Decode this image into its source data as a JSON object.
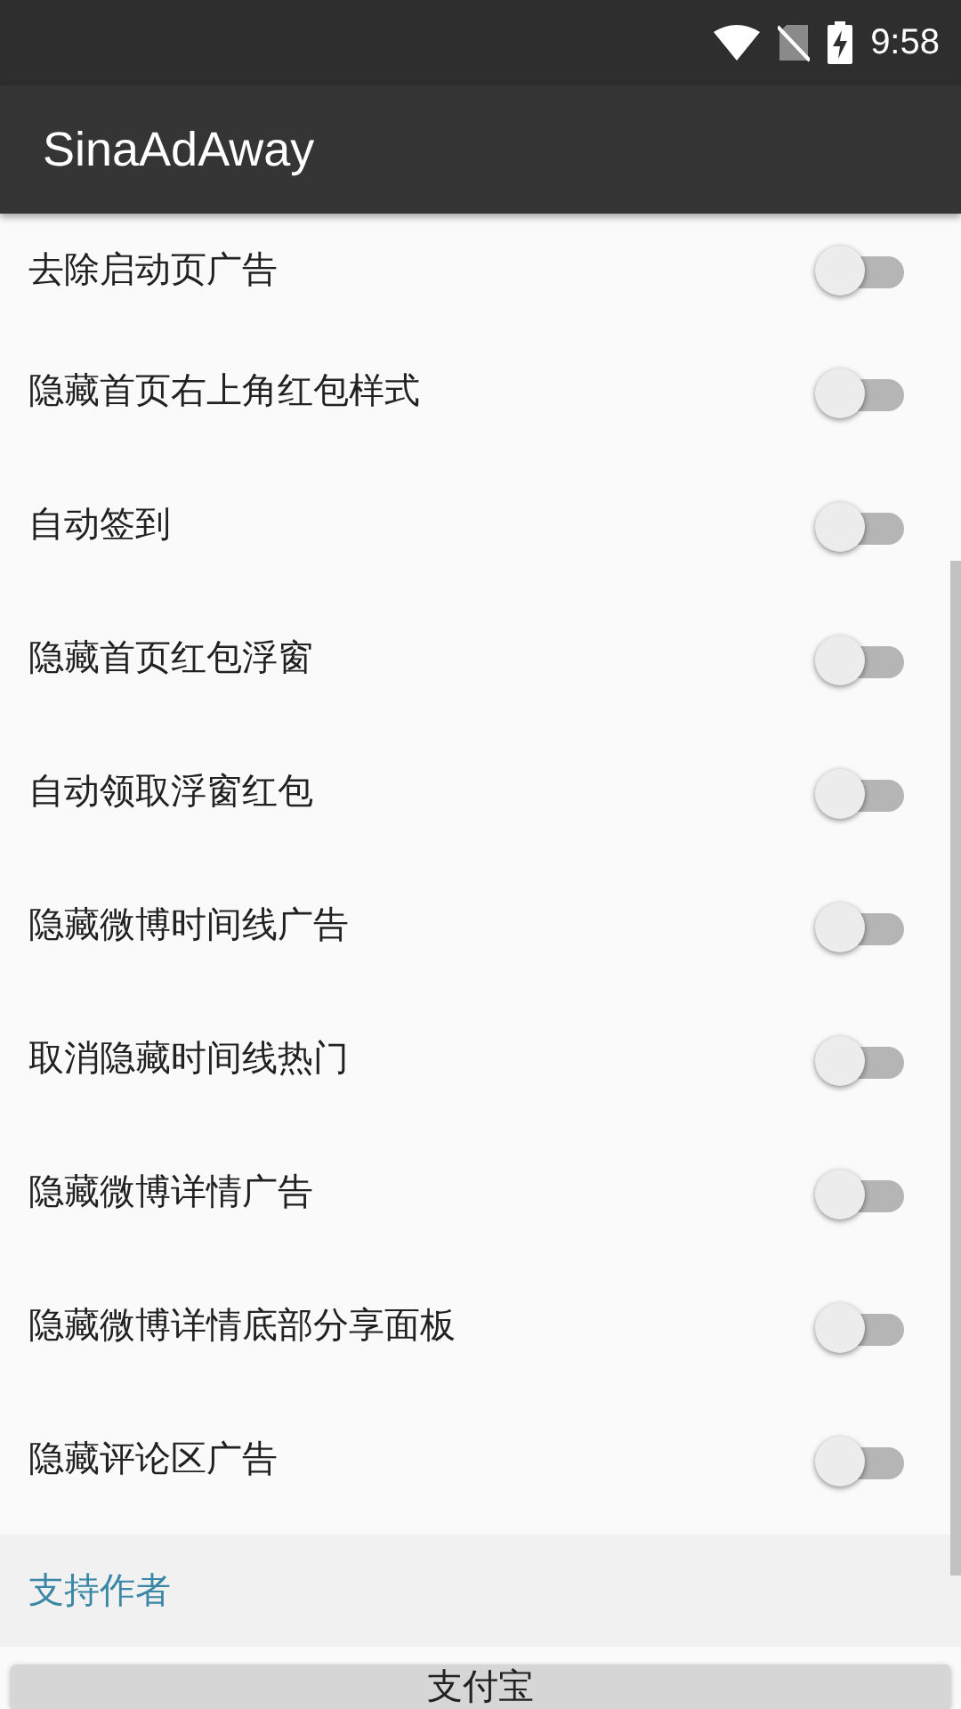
{
  "status_bar": {
    "time": "9:58"
  },
  "toolbar": {
    "title": "SinaAdAway"
  },
  "settings": [
    {
      "label": "去除启动页广告",
      "on": false
    },
    {
      "label": "隐藏首页右上角红包样式",
      "on": false
    },
    {
      "label": "自动签到",
      "on": false
    },
    {
      "label": "隐藏首页红包浮窗",
      "on": false
    },
    {
      "label": "自动领取浮窗红包",
      "on": false
    },
    {
      "label": "隐藏微博时间线广告",
      "on": false
    },
    {
      "label": "取消隐藏时间线热门",
      "on": false
    },
    {
      "label": "隐藏微博详情广告",
      "on": false
    },
    {
      "label": "隐藏微博详情底部分享面板",
      "on": false
    },
    {
      "label": "隐藏评论区广告",
      "on": false
    }
  ],
  "section": {
    "title": "支持作者"
  },
  "buttons": [
    "支付宝"
  ]
}
